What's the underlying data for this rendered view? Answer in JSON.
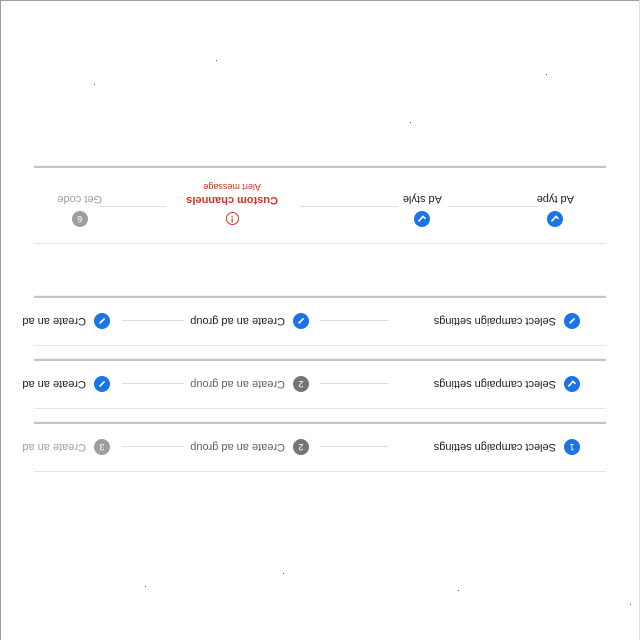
{
  "colors": {
    "accent": "#1a73e8",
    "pending": "#757575",
    "disabled": "#9e9e9e",
    "error": "#d93025",
    "connector": "#dadce0"
  },
  "stepper_1": {
    "steps": [
      {
        "number": "1",
        "label": "Select campaign settings",
        "state": "active"
      },
      {
        "number": "2",
        "label": "Create an ad group",
        "state": "pending"
      },
      {
        "number": "3",
        "label": "Create an ad",
        "state": "disabled"
      }
    ]
  },
  "stepper_2": {
    "steps": [
      {
        "label": "Select campaign settings",
        "state": "done",
        "icon": "check-icon"
      },
      {
        "number": "2",
        "label": "Create an ad group",
        "state": "pending"
      },
      {
        "label": "Create an ad",
        "state": "editable",
        "icon": "pencil-icon"
      }
    ]
  },
  "stepper_3": {
    "steps": [
      {
        "label": "Select campaign settings",
        "state": "editable",
        "icon": "pencil-icon"
      },
      {
        "label": "Create an ad group",
        "state": "editable",
        "icon": "pencil-icon"
      },
      {
        "label": "Create an ad",
        "state": "editable",
        "icon": "pencil-icon"
      }
    ]
  },
  "stepper_4": {
    "steps": [
      {
        "label": "Ad type",
        "state": "done",
        "icon": "check-icon"
      },
      {
        "label": "Ad style",
        "state": "done",
        "icon": "check-icon"
      },
      {
        "label": "Custom channels",
        "state": "error",
        "icon": "error-icon",
        "message": "Alert message"
      },
      {
        "number": "6",
        "label": "Get code",
        "state": "disabled"
      }
    ]
  }
}
